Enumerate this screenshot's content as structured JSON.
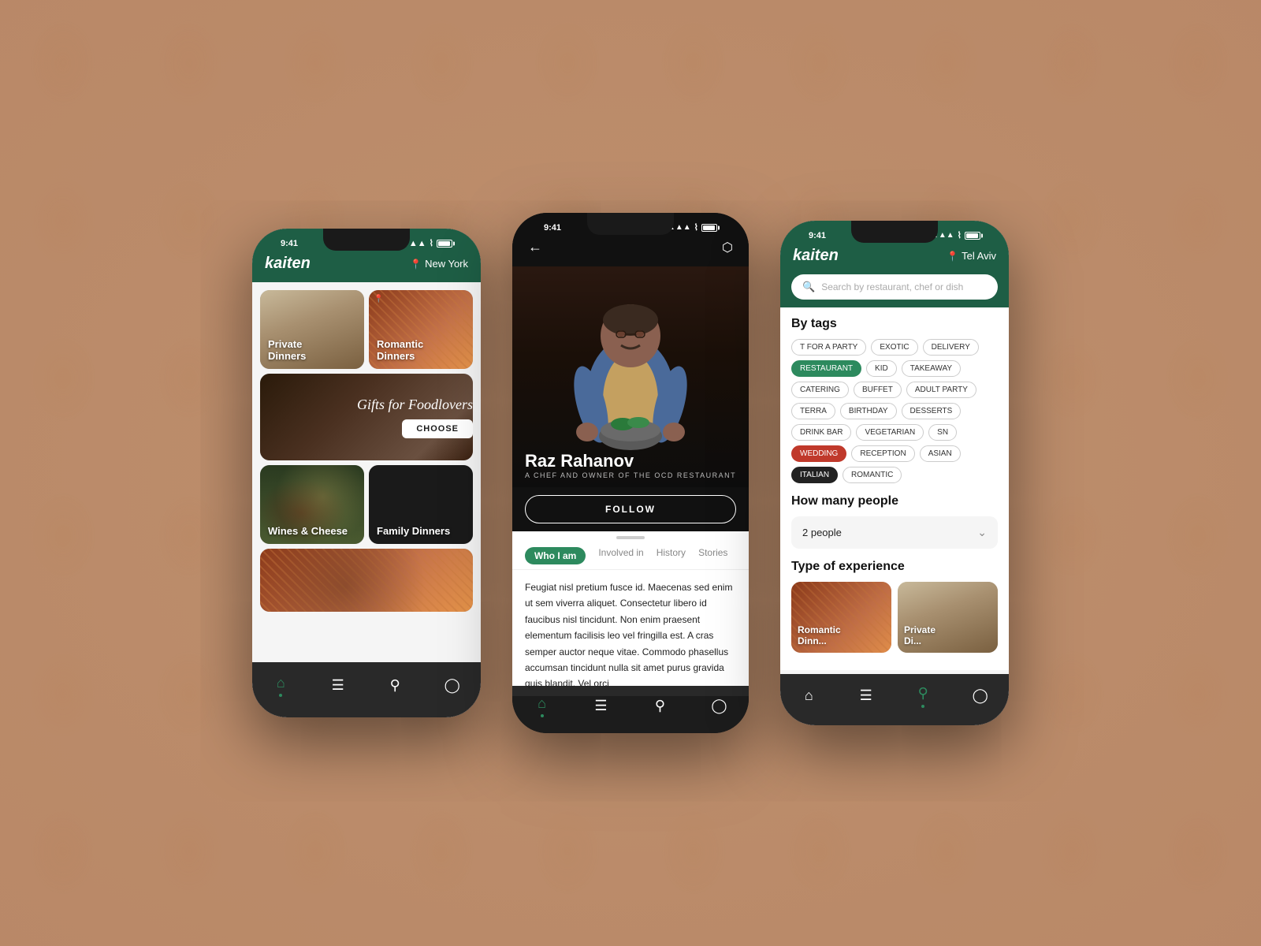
{
  "background": {
    "color": "#c4987a"
  },
  "phone1": {
    "status": {
      "time": "9:41",
      "location": "New York"
    },
    "logo": "kaiten",
    "cards": [
      {
        "id": "private-dinners",
        "label": "Private\nDinners",
        "type": "private"
      },
      {
        "id": "romantic-dinners",
        "label": "Romantic\nDinners",
        "type": "romantic"
      },
      {
        "id": "gifts",
        "label": "Gifts for Foodlovers",
        "type": "gifts"
      },
      {
        "id": "wines-cheese",
        "label": "Wines & Cheese",
        "type": "wines"
      },
      {
        "id": "family-dinners",
        "label": "Family Dinners",
        "type": "family"
      },
      {
        "id": "pasta",
        "label": "",
        "type": "pasta"
      }
    ],
    "gifts_cta": "CHOOSE",
    "nav": {
      "items": [
        "home",
        "menu",
        "search",
        "profile"
      ]
    }
  },
  "phone2": {
    "status": {
      "time": "9:41"
    },
    "chef": {
      "name": "Raz Rahanov",
      "subtitle": "A CHEF AND OWNER OF THE OCD RESTAURANT",
      "follow_label": "FOLLOW"
    },
    "tabs": [
      {
        "label": "Who I am",
        "active": true
      },
      {
        "label": "Involved in",
        "active": false
      },
      {
        "label": "History",
        "active": false
      },
      {
        "label": "Stories",
        "active": false
      }
    ],
    "bio": "Feugiat nisl pretium fusce id. Maecenas sed enim ut sem viverra aliquet. Consectetur libero id faucibus nisl tincidunt. Non enim praesent elementum facilisis leo vel fringilla est. A cras semper auctor neque vitae. Commodo phasellus accumsan tincidunt nulla sit amet purus gravida quis blandit. Vel orci"
  },
  "phone3": {
    "status": {
      "time": "9:41",
      "location": "Tel Aviv"
    },
    "logo": "kaiten",
    "search": {
      "placeholder": "Search by restaurant, chef or dish"
    },
    "by_tags": {
      "title": "By tags",
      "tags": [
        {
          "label": "T FOR A PARTY",
          "active": false
        },
        {
          "label": "EXOTIC",
          "active": false
        },
        {
          "label": "DELIVERY",
          "active": false
        },
        {
          "label": "RESTAURANT",
          "active": true,
          "style": "green"
        },
        {
          "label": "KID",
          "active": false
        },
        {
          "label": "TAKEAWAY",
          "active": false
        },
        {
          "label": "CATERING",
          "active": false
        },
        {
          "label": "BUFFET",
          "active": false
        },
        {
          "label": "ADULT PARTY",
          "active": false
        },
        {
          "label": "TERRA",
          "active": false
        },
        {
          "label": "BIRTHDAY",
          "active": false
        },
        {
          "label": "DESSERTS",
          "active": false
        },
        {
          "label": "DRINK BAR",
          "active": false
        },
        {
          "label": "VEGETARIAN",
          "active": false
        },
        {
          "label": "SN",
          "active": false
        },
        {
          "label": "WEDDING",
          "active": true,
          "style": "red"
        },
        {
          "label": "RECEPTION",
          "active": false
        },
        {
          "label": "ASIAN",
          "active": false
        },
        {
          "label": "ITALIAN",
          "active": true,
          "style": "dark"
        },
        {
          "label": "ROMANTIC",
          "active": false
        }
      ]
    },
    "people": {
      "title": "How many people",
      "value": "2 people"
    },
    "experience": {
      "title": "Type of experience",
      "cards": [
        {
          "label": "Romantic\nDinn...",
          "type": "romantic"
        },
        {
          "label": "Private\nDi...",
          "type": "private"
        }
      ]
    }
  }
}
